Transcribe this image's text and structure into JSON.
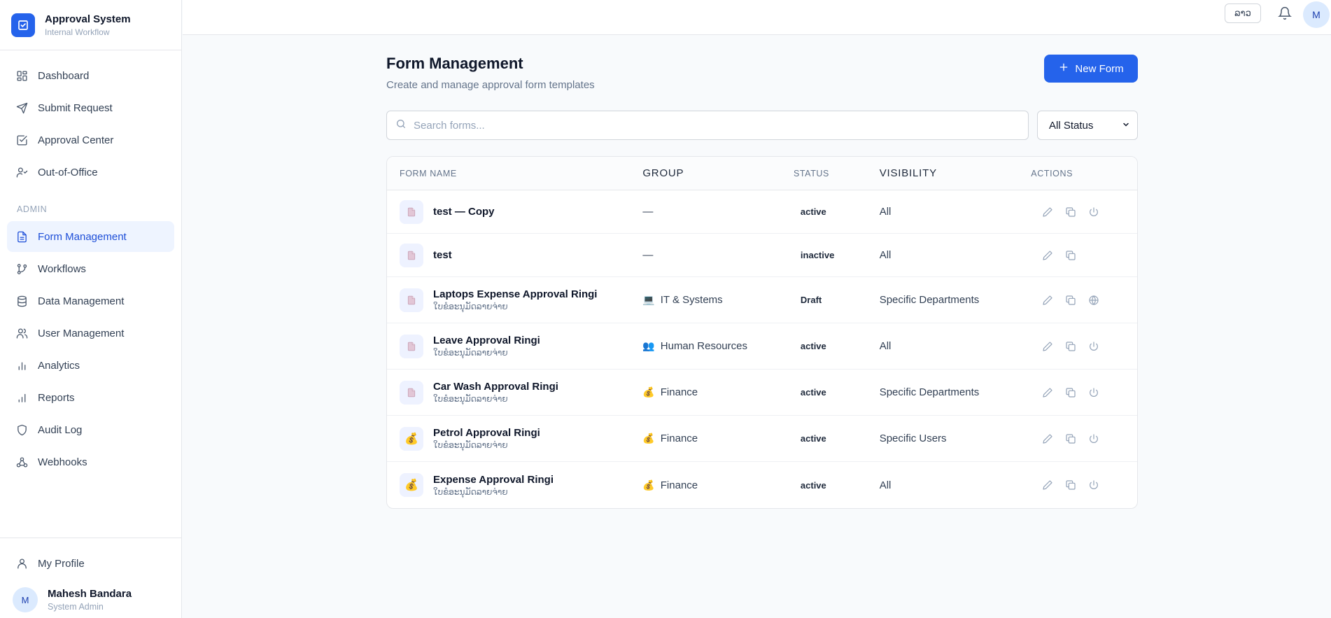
{
  "brand": {
    "title": "Approval System",
    "subtitle": "Internal Workflow"
  },
  "nav": {
    "main": [
      {
        "label": "Dashboard",
        "icon": "grid-icon"
      },
      {
        "label": "Submit Request",
        "icon": "send-icon"
      },
      {
        "label": "Approval Center",
        "icon": "check-square-icon"
      },
      {
        "label": "Out-of-Office",
        "icon": "user-away-icon"
      }
    ],
    "admin_label": "ADMIN",
    "admin": [
      {
        "label": "Form Management",
        "icon": "file-icon",
        "active": true
      },
      {
        "label": "Workflows",
        "icon": "git-branch-icon"
      },
      {
        "label": "Data Management",
        "icon": "database-icon"
      },
      {
        "label": "User Management",
        "icon": "users-icon"
      },
      {
        "label": "Analytics",
        "icon": "bar-chart-icon"
      },
      {
        "label": "Reports",
        "icon": "bar-chart-icon"
      },
      {
        "label": "Audit Log",
        "icon": "shield-icon"
      },
      {
        "label": "Webhooks",
        "icon": "webhook-icon"
      }
    ],
    "profile": "My Profile"
  },
  "user": {
    "initial": "M",
    "name": "Mahesh Bandara",
    "role": "System Admin"
  },
  "topbar": {
    "lang": "ລາວ",
    "avatar": "M"
  },
  "page": {
    "title": "Form Management",
    "subtitle": "Create and manage approval form templates",
    "new_button": "New Form"
  },
  "search": {
    "placeholder": "Search forms..."
  },
  "filter": {
    "status_selected": "All Status"
  },
  "table": {
    "headers": {
      "name": "FORM NAME",
      "group": "GROUP",
      "status": "STATUS",
      "visibility": "VISIBILITY",
      "actions": "ACTIONS"
    },
    "rows": [
      {
        "name": "test — Copy",
        "subtitle": "",
        "group": "—",
        "group_emoji": "",
        "status": "active",
        "visibility": "All",
        "icon": "📄",
        "third_action": "power"
      },
      {
        "name": "test",
        "subtitle": "",
        "group": "—",
        "group_emoji": "",
        "status": "inactive",
        "visibility": "All",
        "icon": "📄",
        "third_action": ""
      },
      {
        "name": "Laptops Expense Approval Ringi",
        "subtitle": "ໃບຂໍອະນຸມັດລາຍຈ່າຍ",
        "group": "IT & Systems",
        "group_emoji": "💻",
        "status": "Draft",
        "visibility": "Specific Departments",
        "icon": "📄",
        "third_action": "globe"
      },
      {
        "name": "Leave Approval Ringi",
        "subtitle": "ໃບຂໍອະນຸມັດລາຍຈ່າຍ",
        "group": "Human Resources",
        "group_emoji": "👥",
        "status": "active",
        "visibility": "All",
        "icon": "📄",
        "third_action": "power"
      },
      {
        "name": "Car Wash Approval Ringi",
        "subtitle": "ໃບຂໍອະນຸມັດລາຍຈ່າຍ",
        "group": "Finance",
        "group_emoji": "💰",
        "status": "active",
        "visibility": "Specific Departments",
        "icon": "📄",
        "third_action": "power"
      },
      {
        "name": "Petrol Approval Ringi",
        "subtitle": "ໃບຂໍອະນຸມັດລາຍຈ່າຍ",
        "group": "Finance",
        "group_emoji": "💰",
        "status": "active",
        "visibility": "Specific Users",
        "icon": "💰",
        "third_action": "power"
      },
      {
        "name": "Expense Approval Ringi",
        "subtitle": "ໃບຂໍອະນຸມັດລາຍຈ່າຍ",
        "group": "Finance",
        "group_emoji": "💰",
        "status": "active",
        "visibility": "All",
        "icon": "💰",
        "third_action": "power"
      }
    ]
  },
  "colors": {
    "accent": "#2563eb",
    "active_nav_bg": "#eef4ff"
  }
}
